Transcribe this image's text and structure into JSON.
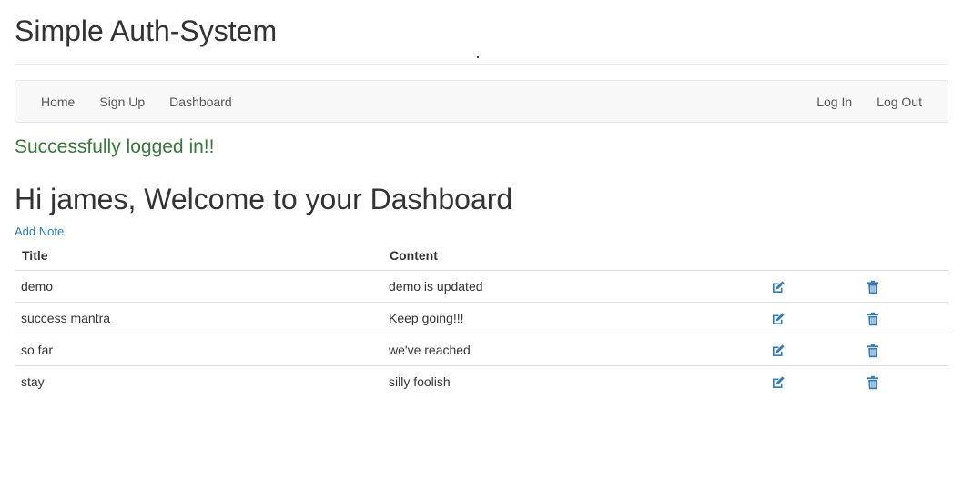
{
  "app": {
    "title": "Simple Auth-System"
  },
  "navbar": {
    "left": [
      {
        "label": "Home"
      },
      {
        "label": "Sign Up"
      },
      {
        "label": "Dashboard"
      }
    ],
    "right": [
      {
        "label": "Log In"
      },
      {
        "label": "Log Out"
      }
    ]
  },
  "flash": {
    "message": "Successfully logged in!!",
    "color": "#3c763d"
  },
  "dashboard": {
    "welcome": "Hi james, Welcome to your Dashboard",
    "add_note_label": "Add Note"
  },
  "table": {
    "headers": {
      "title": "Title",
      "content": "Content"
    },
    "rows": [
      {
        "title": "demo",
        "content": "demo is updated",
        "edit_icon": "edit-icon",
        "delete_icon": "trash-icon"
      },
      {
        "title": "success mantra",
        "content": "Keep going!!!",
        "edit_icon": "edit-icon",
        "delete_icon": "trash-icon"
      },
      {
        "title": "so far",
        "content": "we've reached",
        "edit_icon": "edit-icon",
        "delete_icon": "trash-icon"
      },
      {
        "title": "stay",
        "content": "silly foolish",
        "edit_icon": "edit-icon",
        "delete_icon": "trash-icon"
      }
    ]
  },
  "colors": {
    "link": "#337ab7",
    "icon": "#337ab7",
    "navbar_bg": "#f8f8f8"
  }
}
